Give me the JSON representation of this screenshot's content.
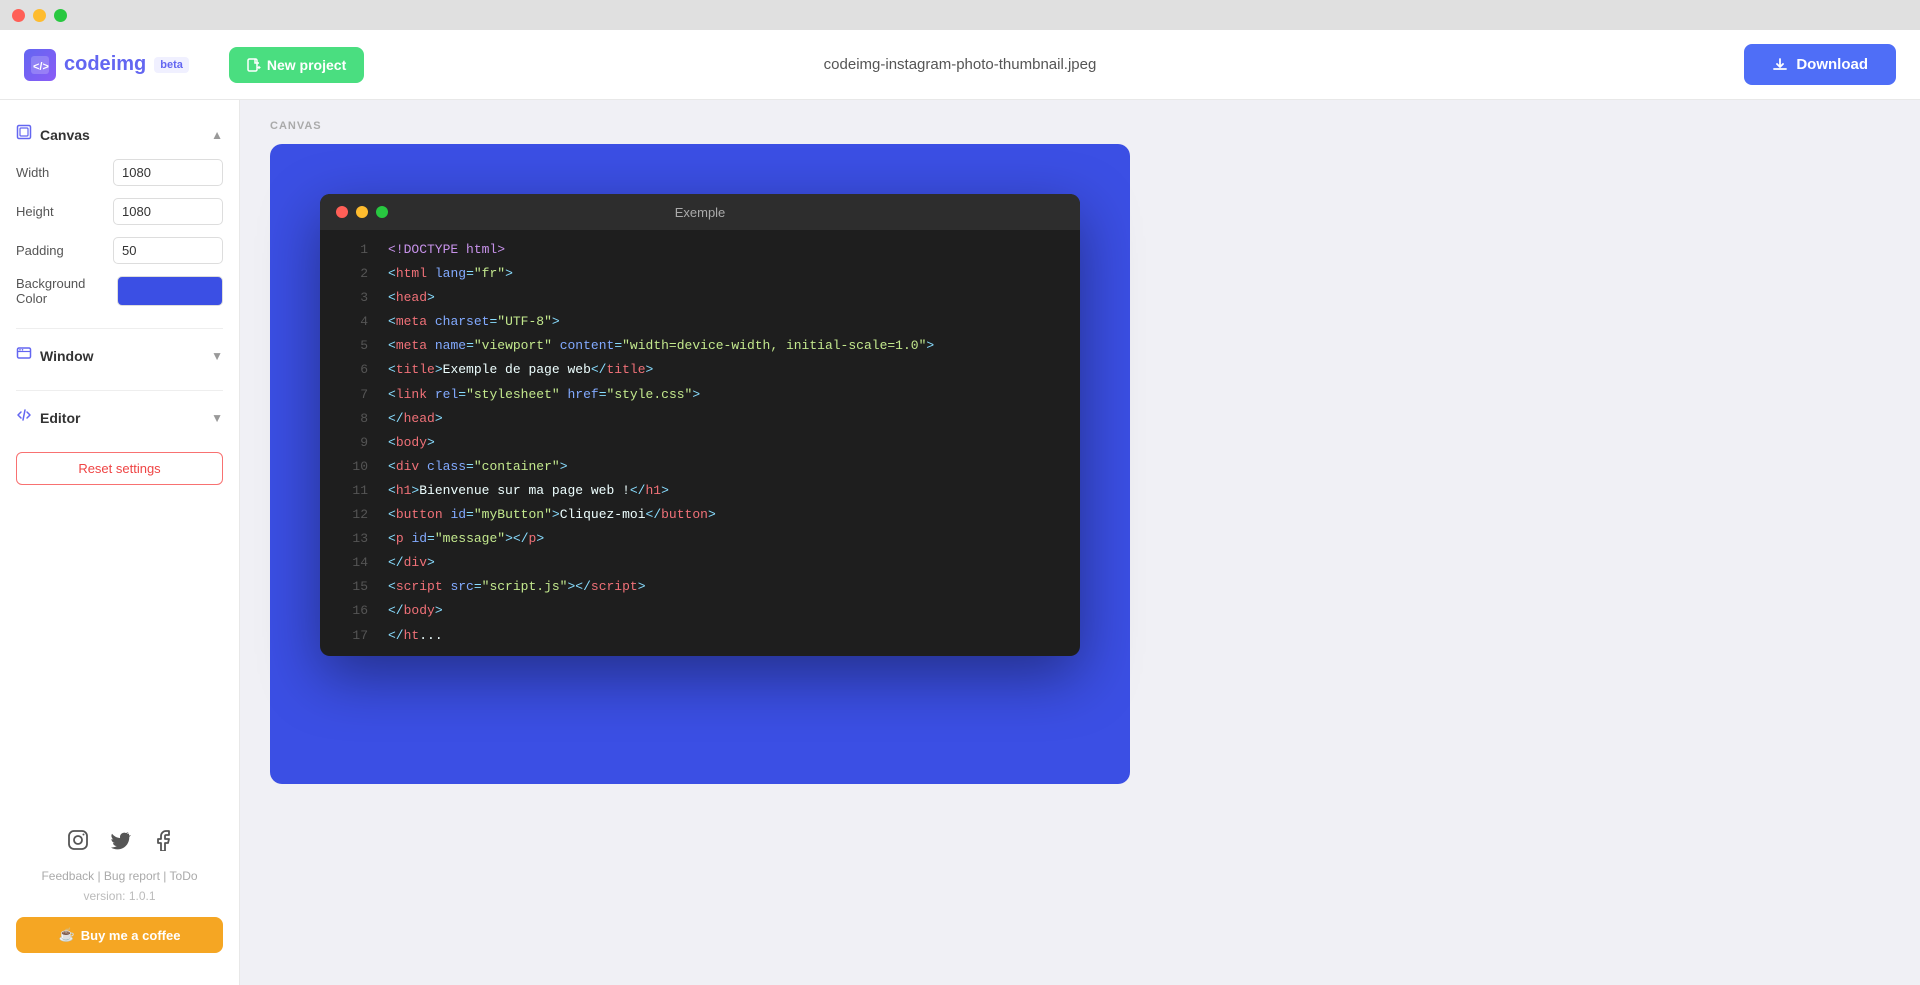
{
  "titlebar": {
    "dots": [
      "red",
      "yellow",
      "green"
    ]
  },
  "header": {
    "logo_text_code": "code",
    "logo_text_img": "img",
    "beta_label": "beta",
    "new_project_label": "New project",
    "filename": "codeimg-instagram-photo-thumbnail.jpeg",
    "download_label": "Download"
  },
  "sidebar": {
    "canvas_section": {
      "title": "Canvas",
      "fields": {
        "width_label": "Width",
        "width_value": "1080",
        "height_label": "Height",
        "height_value": "1080",
        "padding_label": "Padding",
        "padding_value": "50",
        "bg_color_label": "Background Color"
      }
    },
    "window_section": {
      "title": "Window"
    },
    "editor_section": {
      "title": "Editor"
    },
    "reset_label": "Reset settings",
    "social": {
      "instagram": "instagram",
      "twitter": "twitter",
      "facebook": "facebook"
    },
    "footer_links": "Feedback | Bug report | ToDo",
    "version": "version: 1.0.1",
    "coffee_btn": "Buy me a coffee"
  },
  "canvas": {
    "label": "CANVAS",
    "window_title": "Exemple",
    "code_lines": [
      {
        "num": 1,
        "tokens": [
          {
            "t": "<!DOCTYPE html>",
            "c": "kw"
          }
        ]
      },
      {
        "num": 2,
        "tokens": [
          {
            "t": "<",
            "c": "punct"
          },
          {
            "t": "html",
            "c": "tag"
          },
          {
            "t": " ",
            "c": "txt"
          },
          {
            "t": "lang",
            "c": "attr"
          },
          {
            "t": "=",
            "c": "punct"
          },
          {
            "t": "\"fr\"",
            "c": "str"
          },
          {
            "t": ">",
            "c": "punct"
          }
        ]
      },
      {
        "num": 3,
        "tokens": [
          {
            "t": "<",
            "c": "punct"
          },
          {
            "t": "head",
            "c": "tag"
          },
          {
            "t": ">",
            "c": "punct"
          }
        ]
      },
      {
        "num": 4,
        "tokens": [
          {
            "t": "  <",
            "c": "punct"
          },
          {
            "t": "meta",
            "c": "tag"
          },
          {
            "t": " ",
            "c": "txt"
          },
          {
            "t": "charset",
            "c": "attr"
          },
          {
            "t": "=",
            "c": "punct"
          },
          {
            "t": "\"UTF-8\"",
            "c": "str"
          },
          {
            "t": ">",
            "c": "punct"
          }
        ]
      },
      {
        "num": 5,
        "tokens": [
          {
            "t": "  <",
            "c": "punct"
          },
          {
            "t": "meta",
            "c": "tag"
          },
          {
            "t": " ",
            "c": "txt"
          },
          {
            "t": "name",
            "c": "attr"
          },
          {
            "t": "=",
            "c": "punct"
          },
          {
            "t": "\"viewport\"",
            "c": "str"
          },
          {
            "t": " ",
            "c": "txt"
          },
          {
            "t": "content",
            "c": "attr"
          },
          {
            "t": "=",
            "c": "punct"
          },
          {
            "t": "\"width=device-width, initial-scale=1.0\"",
            "c": "str"
          },
          {
            "t": ">",
            "c": "punct"
          }
        ]
      },
      {
        "num": 6,
        "tokens": [
          {
            "t": "  <",
            "c": "punct"
          },
          {
            "t": "title",
            "c": "tag"
          },
          {
            "t": ">",
            "c": "punct"
          },
          {
            "t": "Exemple de page web",
            "c": "txt"
          },
          {
            "t": "</",
            "c": "punct"
          },
          {
            "t": "title",
            "c": "tag"
          },
          {
            "t": ">",
            "c": "punct"
          }
        ]
      },
      {
        "num": 7,
        "tokens": [
          {
            "t": "  <",
            "c": "punct"
          },
          {
            "t": "link",
            "c": "tag"
          },
          {
            "t": " ",
            "c": "txt"
          },
          {
            "t": "rel",
            "c": "attr"
          },
          {
            "t": "=",
            "c": "punct"
          },
          {
            "t": "\"stylesheet\"",
            "c": "str"
          },
          {
            "t": " ",
            "c": "txt"
          },
          {
            "t": "href",
            "c": "attr"
          },
          {
            "t": "=",
            "c": "punct"
          },
          {
            "t": "\"style.css\"",
            "c": "str"
          },
          {
            "t": ">",
            "c": "punct"
          }
        ]
      },
      {
        "num": 8,
        "tokens": [
          {
            "t": "</",
            "c": "punct"
          },
          {
            "t": "head",
            "c": "tag"
          },
          {
            "t": ">",
            "c": "punct"
          }
        ]
      },
      {
        "num": 9,
        "tokens": [
          {
            "t": "<",
            "c": "punct"
          },
          {
            "t": "body",
            "c": "tag"
          },
          {
            "t": ">",
            "c": "punct"
          }
        ]
      },
      {
        "num": 10,
        "tokens": [
          {
            "t": "  <",
            "c": "punct"
          },
          {
            "t": "div",
            "c": "tag"
          },
          {
            "t": " ",
            "c": "txt"
          },
          {
            "t": "class",
            "c": "attr"
          },
          {
            "t": "=",
            "c": "punct"
          },
          {
            "t": "\"container\"",
            "c": "str"
          },
          {
            "t": ">",
            "c": "punct"
          }
        ]
      },
      {
        "num": 11,
        "tokens": [
          {
            "t": "    <",
            "c": "punct"
          },
          {
            "t": "h1",
            "c": "tag"
          },
          {
            "t": ">",
            "c": "punct"
          },
          {
            "t": "Bienvenue sur ma page web !",
            "c": "txt"
          },
          {
            "t": "</",
            "c": "punct"
          },
          {
            "t": "h1",
            "c": "tag"
          },
          {
            "t": ">",
            "c": "punct"
          }
        ]
      },
      {
        "num": 12,
        "tokens": [
          {
            "t": "    <",
            "c": "punct"
          },
          {
            "t": "button",
            "c": "tag"
          },
          {
            "t": " ",
            "c": "txt"
          },
          {
            "t": "id",
            "c": "attr"
          },
          {
            "t": "=",
            "c": "punct"
          },
          {
            "t": "\"myButton\"",
            "c": "str"
          },
          {
            "t": ">",
            "c": "punct"
          },
          {
            "t": "Cliquez-moi",
            "c": "txt"
          },
          {
            "t": "</",
            "c": "punct"
          },
          {
            "t": "button",
            "c": "tag"
          },
          {
            "t": ">",
            "c": "punct"
          }
        ]
      },
      {
        "num": 13,
        "tokens": [
          {
            "t": "    <",
            "c": "punct"
          },
          {
            "t": "p",
            "c": "tag"
          },
          {
            "t": " ",
            "c": "txt"
          },
          {
            "t": "id",
            "c": "attr"
          },
          {
            "t": "=",
            "c": "punct"
          },
          {
            "t": "\"message\"",
            "c": "str"
          },
          {
            "t": ">",
            "c": "punct"
          },
          {
            "t": "</",
            "c": "punct"
          },
          {
            "t": "p",
            "c": "tag"
          },
          {
            "t": ">",
            "c": "punct"
          }
        ]
      },
      {
        "num": 14,
        "tokens": [
          {
            "t": "  </",
            "c": "punct"
          },
          {
            "t": "div",
            "c": "tag"
          },
          {
            "t": ">",
            "c": "punct"
          }
        ]
      },
      {
        "num": 15,
        "tokens": [
          {
            "t": "  <",
            "c": "punct"
          },
          {
            "t": "script",
            "c": "tag"
          },
          {
            "t": " ",
            "c": "txt"
          },
          {
            "t": "src",
            "c": "attr"
          },
          {
            "t": "=",
            "c": "punct"
          },
          {
            "t": "\"script.js\"",
            "c": "str"
          },
          {
            "t": ">",
            "c": "punct"
          },
          {
            "t": "</",
            "c": "punct"
          },
          {
            "t": "script",
            "c": "tag"
          },
          {
            "t": ">",
            "c": "punct"
          }
        ]
      },
      {
        "num": 16,
        "tokens": [
          {
            "t": "</",
            "c": "punct"
          },
          {
            "t": "body",
            "c": "tag"
          },
          {
            "t": ">",
            "c": "punct"
          }
        ]
      },
      {
        "num": 17,
        "tokens": [
          {
            "t": "</",
            "c": "punct"
          },
          {
            "t": "ht",
            "c": "tag"
          },
          {
            "t": "...",
            "c": "txt"
          }
        ]
      }
    ]
  },
  "colors": {
    "accent": "#6366f1",
    "green_btn": "#4ade80",
    "blue_btn": "#4f6ef7",
    "canvas_bg": "#3b4fe4",
    "bg_color_swatch": "#3b4fe4"
  }
}
